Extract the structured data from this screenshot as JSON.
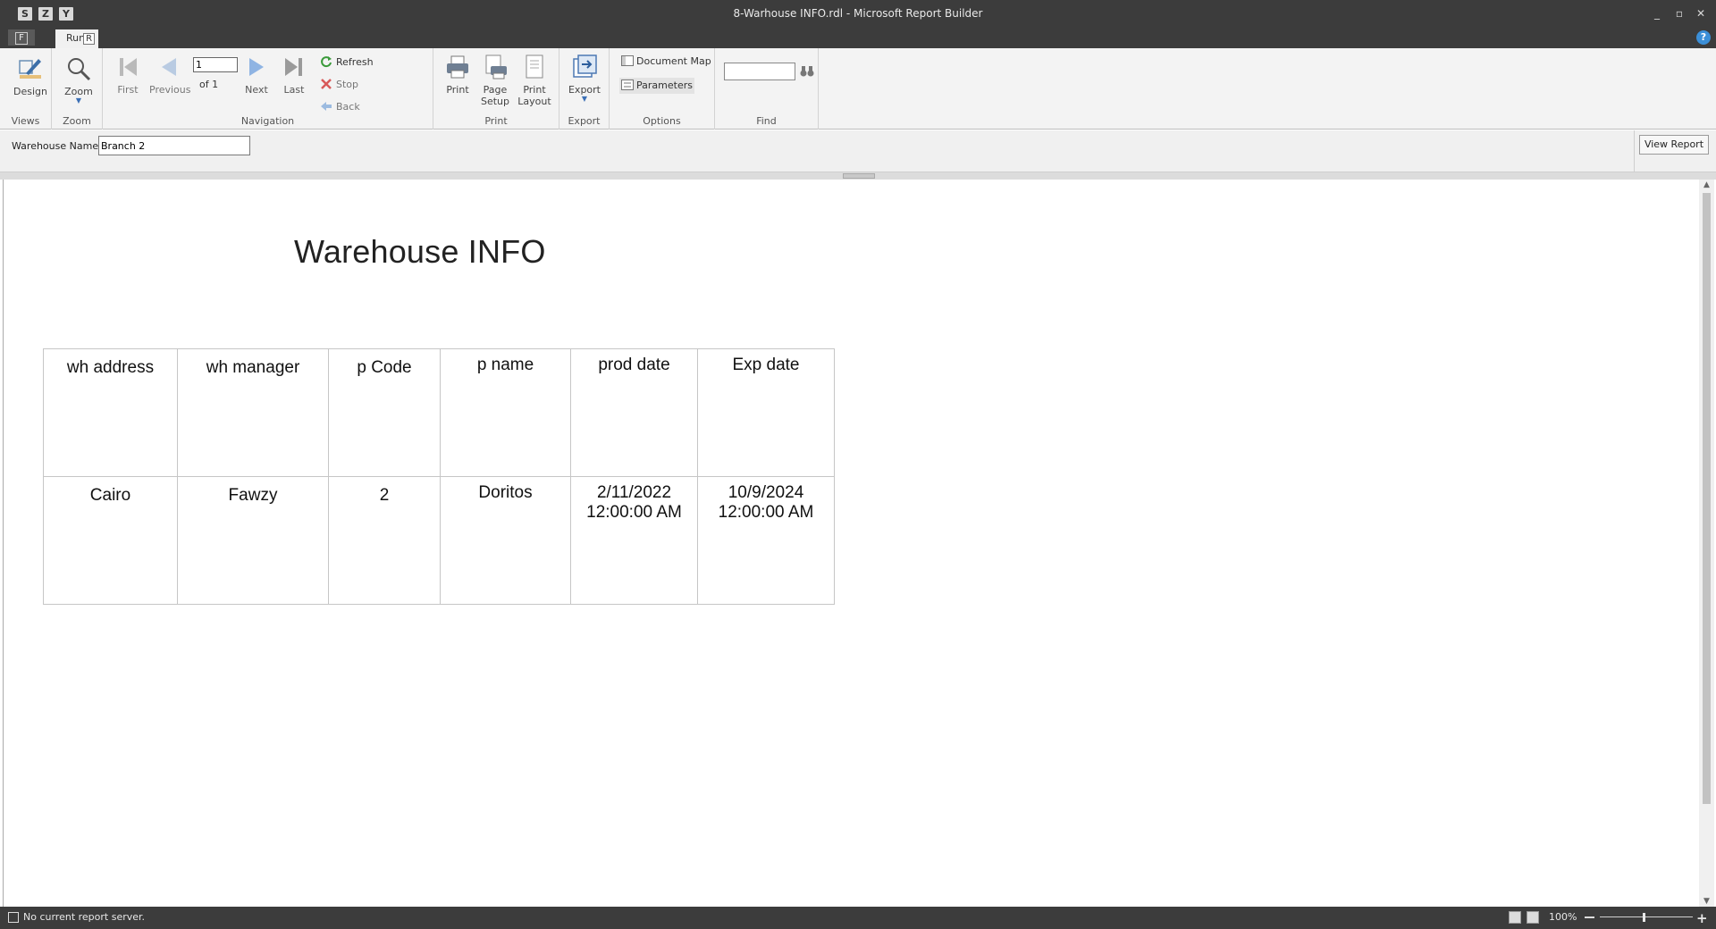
{
  "window": {
    "title": "8-Warhouse INFO.rdl - Microsoft Report Builder",
    "quick_access": [
      "S",
      "Z",
      "Y"
    ],
    "controls": {
      "minimize": "_",
      "restore": "▫",
      "close": "✕"
    }
  },
  "tabs": {
    "file_key": "F",
    "run_label": "Run",
    "run_key": "R",
    "help": "?"
  },
  "ribbon": {
    "views": {
      "label": "Views",
      "design": "Design"
    },
    "zoom": {
      "label": "Zoom",
      "zoom": "Zoom"
    },
    "navigation": {
      "label": "Navigation",
      "first": "First",
      "previous": "Previous",
      "page_value": "1",
      "of_text": "of  1",
      "next": "Next",
      "last": "Last",
      "refresh": "Refresh",
      "stop": "Stop",
      "back": "Back"
    },
    "print": {
      "label": "Print",
      "print": "Print",
      "page_setup_1": "Page",
      "page_setup_2": "Setup",
      "print_layout_1": "Print",
      "print_layout_2": "Layout"
    },
    "export": {
      "label": "Export",
      "export": "Export"
    },
    "options": {
      "label": "Options",
      "document_map": "Document Map",
      "parameters": "Parameters"
    },
    "find": {
      "label": "Find",
      "value": ""
    }
  },
  "parameters": {
    "warehouse_name_label": "Warehouse Name",
    "warehouse_name_value": "Branch 2",
    "view_report": "View Report"
  },
  "report": {
    "title": "Warehouse INFO",
    "columns": [
      "wh address",
      "wh manager",
      "p Code",
      "p name",
      "prod date",
      "Exp date"
    ],
    "rows": [
      [
        "Cairo",
        "Fawzy",
        "2",
        "Doritos",
        "2/11/2022 12:00:00 AM",
        "10/9/2024 12:00:00 AM"
      ]
    ]
  },
  "status": {
    "text": "No current report server.",
    "zoom": "100%",
    "zoom_level": 1.0
  }
}
